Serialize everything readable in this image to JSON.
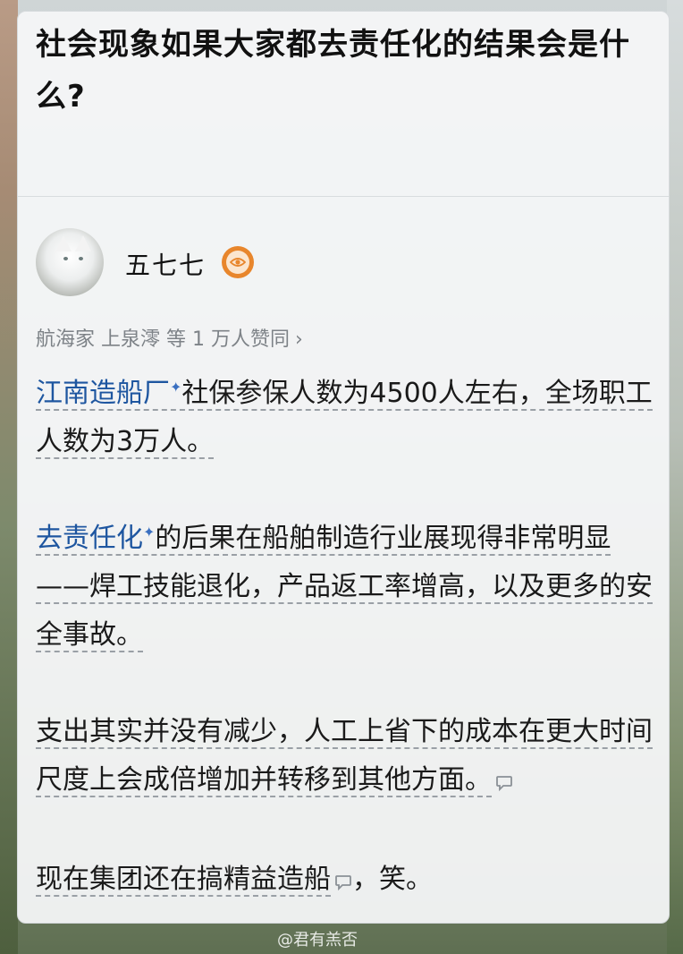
{
  "question": {
    "title": "社会现象如果大家都去责任化的结果会是什么?"
  },
  "answer": {
    "author": {
      "name": "五七七",
      "badge_icon": "eye-icon"
    },
    "endorsement": "航海家 上泉澪 等 1 万人赞同",
    "chevron": "›",
    "paragraphs": {
      "p1": {
        "link": "江南造船厂",
        "text": "社保参保人数为4500人左右，全场职工人数为3万人。"
      },
      "p2": {
        "link": "去责任化",
        "text": "的后果在船舶制造行业展现得非常明显——焊工技能退化，产品返工率增高，以及更多的安全事故。"
      },
      "p3": {
        "text": "支出其实并没有减少，人工上省下的成本在更大时间尺度上会成倍增加并转移到其他方面。"
      },
      "p4": {
        "text_a": "现在集团还在搞精益造船",
        "text_b": "，笑。"
      }
    },
    "spark_symbol": "✦"
  },
  "watermark": "@君有羔否",
  "colors": {
    "link": "#1e56a0",
    "badge": "#e8862c",
    "muted": "#7d8287"
  }
}
